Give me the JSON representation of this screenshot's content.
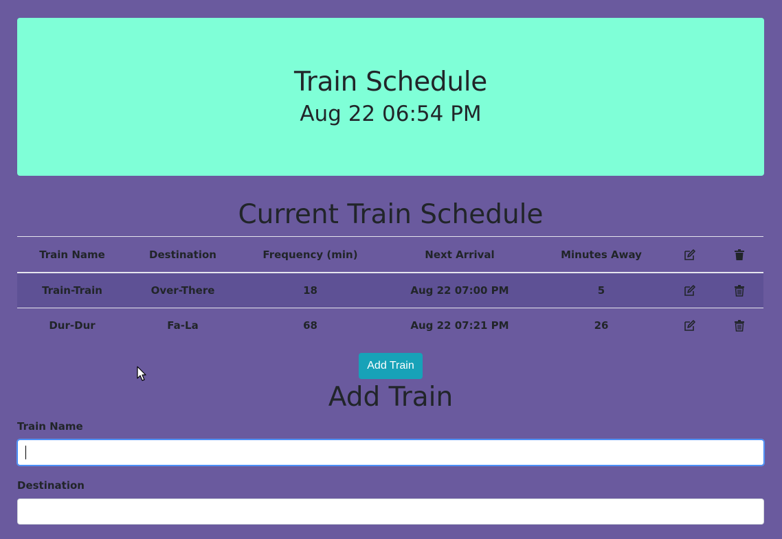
{
  "header": {
    "title": "Train Schedule",
    "datetime": "Aug 22 06:54 PM"
  },
  "schedule": {
    "title": "Current Train Schedule",
    "columns": [
      "Train Name",
      "Destination",
      "Frequency (min)",
      "Next Arrival",
      "Minutes Away"
    ],
    "header_icons": [
      "edit-icon",
      "trash-icon"
    ],
    "rows": [
      {
        "name": "Train-Train",
        "destination": "Over-There",
        "frequency": "18",
        "next_arrival": "Aug 22 07:00 PM",
        "minutes_away": "5"
      },
      {
        "name": "Dur-Dur",
        "destination": "Fa-La",
        "frequency": "68",
        "next_arrival": "Aug 22 07:21 PM",
        "minutes_away": "26"
      }
    ]
  },
  "add_button": {
    "label": "Add Train"
  },
  "form": {
    "title": "Add Train",
    "train_name_label": "Train Name",
    "train_name_value": "",
    "destination_label": "Destination",
    "destination_value": ""
  },
  "colors": {
    "background": "#6a5a9e",
    "jumbotron": "#7fffd7",
    "button": "#17a2b8",
    "stripe": "#5e5195"
  }
}
